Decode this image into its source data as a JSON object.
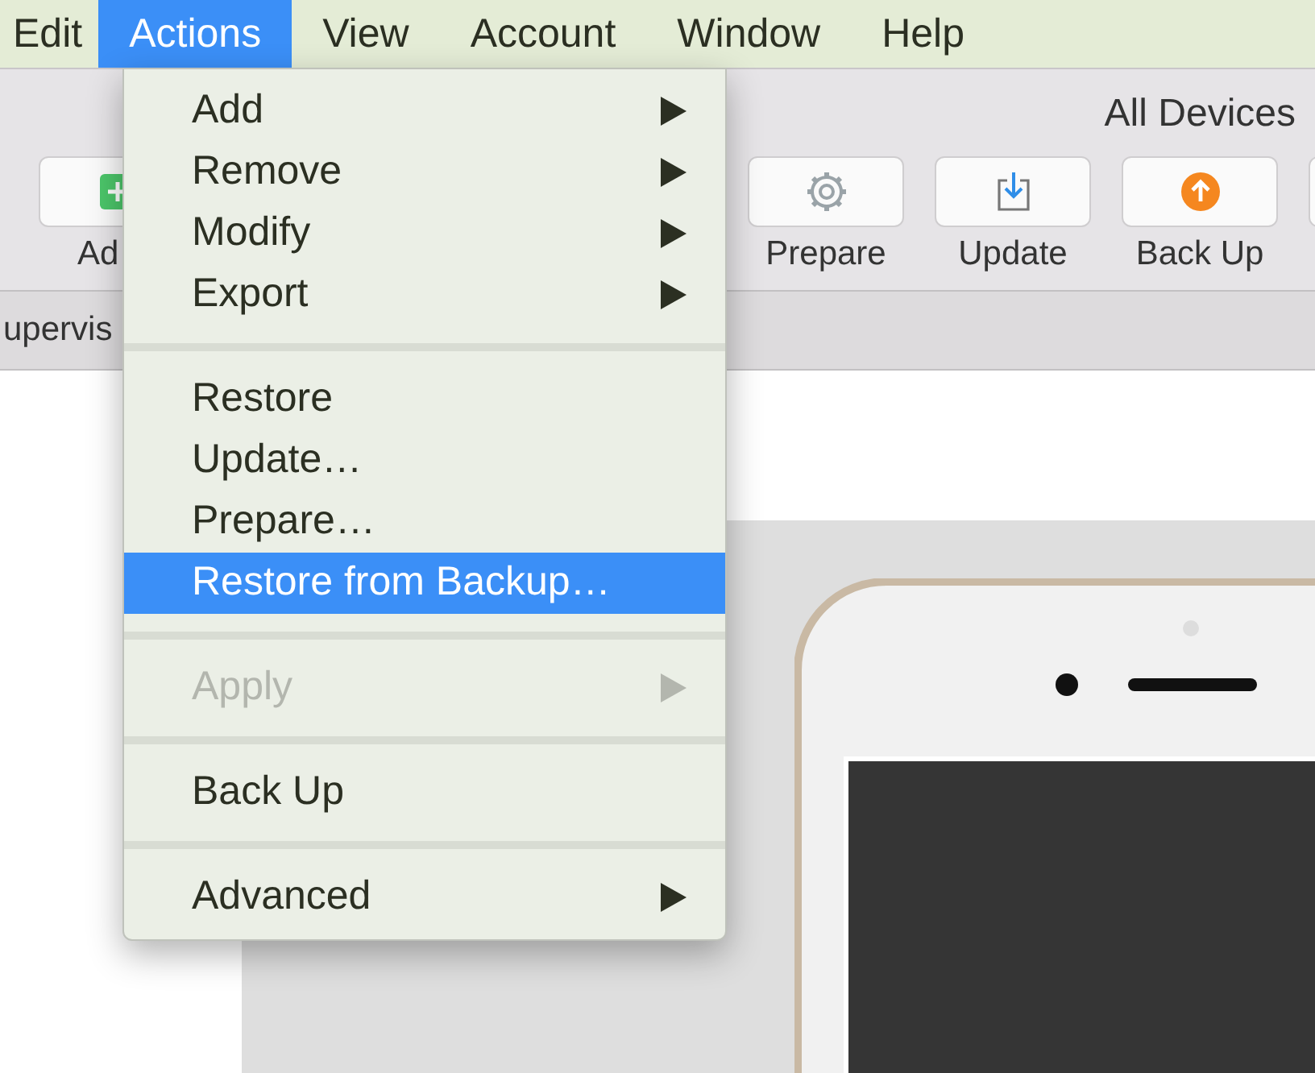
{
  "menu_bar": [
    {
      "label": "Edit",
      "selected": false
    },
    {
      "label": "Actions",
      "selected": true
    },
    {
      "label": "View",
      "selected": false
    },
    {
      "label": "Account",
      "selected": false
    },
    {
      "label": "Window",
      "selected": false
    },
    {
      "label": "Help",
      "selected": false
    }
  ],
  "toolbar": {
    "title": "All Devices",
    "buttons": [
      {
        "label": "Ad"
      },
      {
        "label": "Prepare"
      },
      {
        "label": "Update"
      },
      {
        "label": "Back Up"
      }
    ]
  },
  "filter_bar": {
    "text": "upervis"
  },
  "actions_menu": [
    {
      "kind": "item",
      "label": "Add",
      "submenu": true,
      "disabled": false,
      "selected": false
    },
    {
      "kind": "item",
      "label": "Remove",
      "submenu": true,
      "disabled": false,
      "selected": false
    },
    {
      "kind": "item",
      "label": "Modify",
      "submenu": true,
      "disabled": false,
      "selected": false
    },
    {
      "kind": "item",
      "label": "Export",
      "submenu": true,
      "disabled": false,
      "selected": false
    },
    {
      "kind": "separator"
    },
    {
      "kind": "item",
      "label": "Restore",
      "submenu": false,
      "disabled": false,
      "selected": false
    },
    {
      "kind": "item",
      "label": "Update…",
      "submenu": false,
      "disabled": false,
      "selected": false
    },
    {
      "kind": "item",
      "label": "Prepare…",
      "submenu": false,
      "disabled": false,
      "selected": false
    },
    {
      "kind": "item",
      "label": "Restore from Backup…",
      "submenu": false,
      "disabled": false,
      "selected": true
    },
    {
      "kind": "separator"
    },
    {
      "kind": "item",
      "label": "Apply",
      "submenu": true,
      "disabled": true,
      "selected": false
    },
    {
      "kind": "separator"
    },
    {
      "kind": "item",
      "label": "Back Up",
      "submenu": false,
      "disabled": false,
      "selected": false
    },
    {
      "kind": "separator"
    },
    {
      "kind": "item",
      "label": "Advanced",
      "submenu": true,
      "disabled": false,
      "selected": false
    }
  ]
}
